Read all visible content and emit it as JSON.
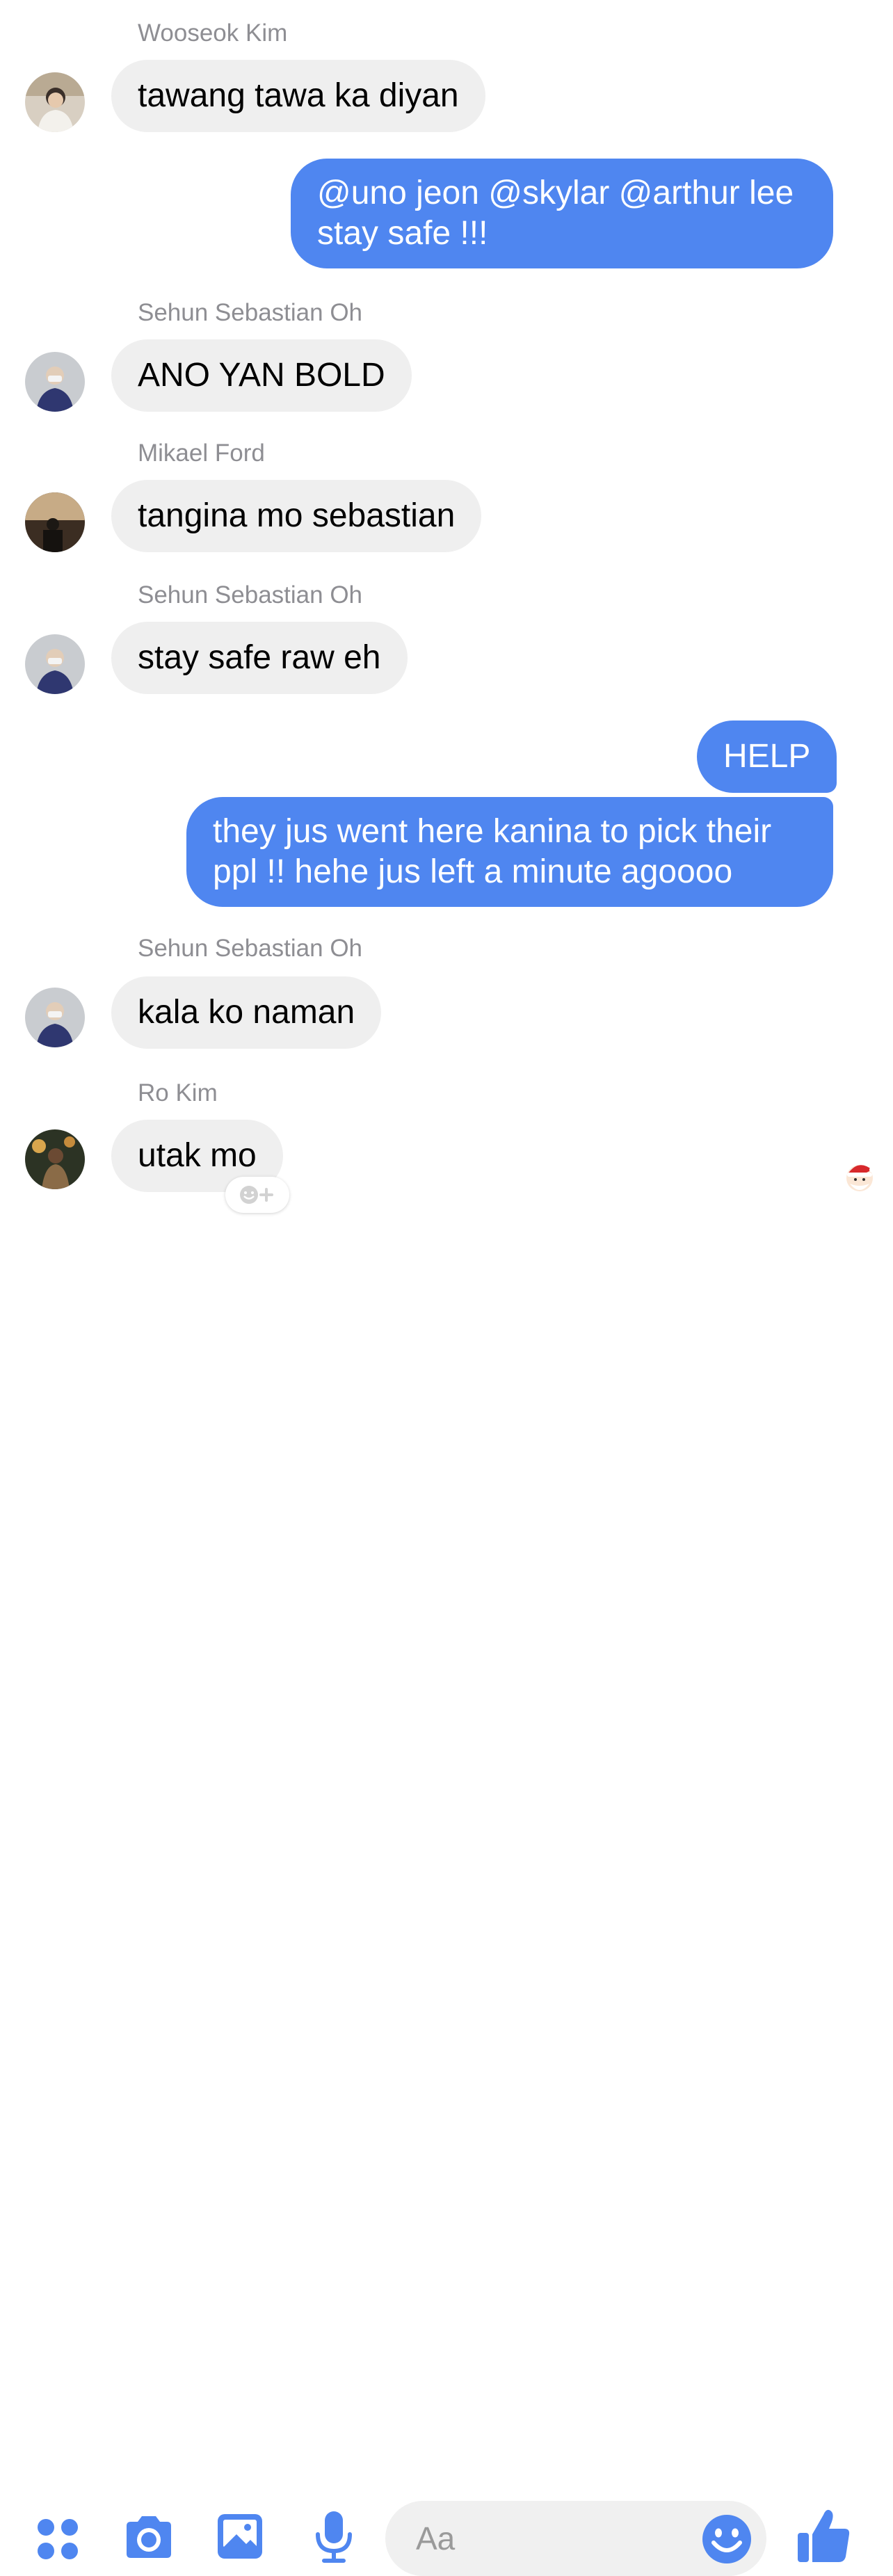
{
  "colors": {
    "accent": "#4f86f0",
    "incoming_bubble": "#efefef",
    "sender_name": "#8e8e93"
  },
  "messages": [
    {
      "sender": "Wooseok Kim",
      "text": "tawang tawa ka diyan"
    },
    {
      "text": "@uno jeon @skylar @arthur lee stay safe !!!"
    },
    {
      "sender": "Sehun Sebastian Oh",
      "text": "ANO YAN BOLD"
    },
    {
      "sender": "Mikael Ford",
      "text": "tangina mo sebastian"
    },
    {
      "sender": "Sehun Sebastian Oh",
      "text": "stay safe raw eh"
    },
    {
      "text": "HELP"
    },
    {
      "text": "they jus went here kanina to pick their ppl !! hehe jus left a minute agoooo"
    },
    {
      "sender": "Sehun Sebastian Oh",
      "text": "kala ko naman"
    },
    {
      "sender": "Ro Kim",
      "text": "utak mo"
    }
  ],
  "composer": {
    "placeholder": "Aa",
    "icons": [
      "more-apps-icon",
      "camera-icon",
      "gallery-icon",
      "microphone-icon",
      "emoji-icon",
      "thumbs-up-icon"
    ]
  },
  "reaction_button_icon": "add-reaction-icon",
  "seen_indicator_icon": "santa-avatar-icon"
}
